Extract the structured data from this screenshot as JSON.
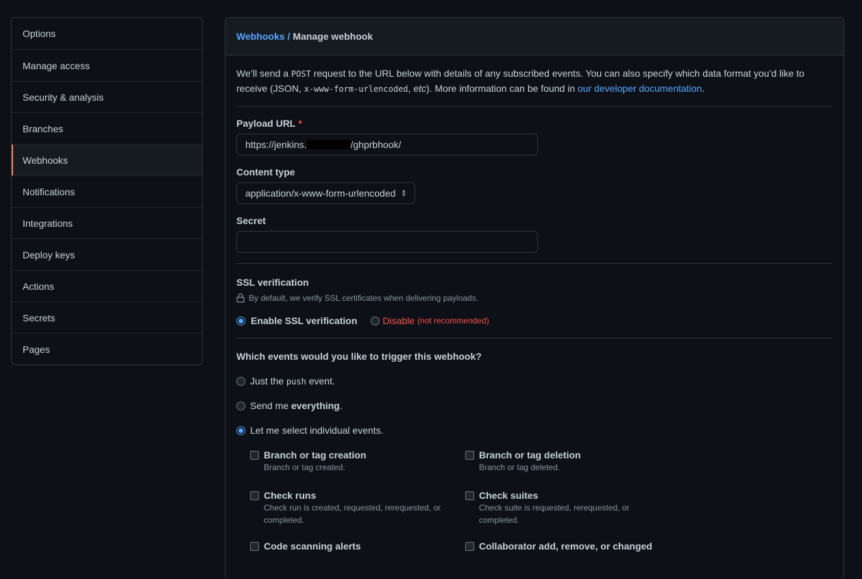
{
  "sidebar": {
    "items": [
      {
        "label": "Options"
      },
      {
        "label": "Manage access"
      },
      {
        "label": "Security & analysis"
      },
      {
        "label": "Branches"
      },
      {
        "label": "Webhooks"
      },
      {
        "label": "Notifications"
      },
      {
        "label": "Integrations"
      },
      {
        "label": "Deploy keys"
      },
      {
        "label": "Actions"
      },
      {
        "label": "Secrets"
      },
      {
        "label": "Pages"
      }
    ],
    "active": "Webhooks"
  },
  "header": {
    "crumb_link": "Webhooks",
    "crumb_sep": "/",
    "title": "Manage webhook"
  },
  "intro": {
    "p1": "We’ll send a ",
    "code1": "POST",
    "p2": " request to the URL below with details of any subscribed events. You can also specify which data format you’d like to receive (JSON, ",
    "code2": "x-www-form-urlencoded",
    "p3": ", ",
    "etc": "etc",
    "p4": "). More information can be found in ",
    "link": "our developer documentation",
    "p5": "."
  },
  "payload": {
    "label": "Payload URL",
    "required_mark": "*",
    "value_prefix": "https://jenkins.",
    "value_suffix": "/ghprbhook/"
  },
  "content_type": {
    "label": "Content type",
    "selected": "application/x-www-form-urlencoded"
  },
  "secret": {
    "label": "Secret",
    "value": ""
  },
  "ssl": {
    "title": "SSL verification",
    "note": "By default, we verify SSL certificates when delivering payloads.",
    "enable_label": "Enable SSL verification",
    "disable_label": "Disable",
    "not_recommended": "(not recommended)",
    "selected": "enable"
  },
  "events": {
    "question": "Which events would you like to trigger this webhook?",
    "opt_push_pre": "Just the ",
    "opt_push_code": "push",
    "opt_push_post": " event.",
    "opt_all_pre": "Send me ",
    "opt_all_bold": "everything",
    "opt_all_post": ".",
    "opt_individual": "Let me select individual events.",
    "selected": "individual",
    "list": [
      {
        "title": "Branch or tag creation",
        "desc": "Branch or tag created."
      },
      {
        "title": "Branch or tag deletion",
        "desc": "Branch or tag deleted."
      },
      {
        "title": "Check runs",
        "desc": "Check run is created, requested, rerequested, or completed."
      },
      {
        "title": "Check suites",
        "desc": "Check suite is requested, rerequested, or completed."
      },
      {
        "title": "Code scanning alerts",
        "desc": ""
      },
      {
        "title": "Collaborator add, remove, or changed",
        "desc": ""
      }
    ]
  },
  "colors": {
    "accent": "#58a6ff",
    "danger": "#f85149",
    "active_marker": "#f78166",
    "background": "#0d1117"
  }
}
